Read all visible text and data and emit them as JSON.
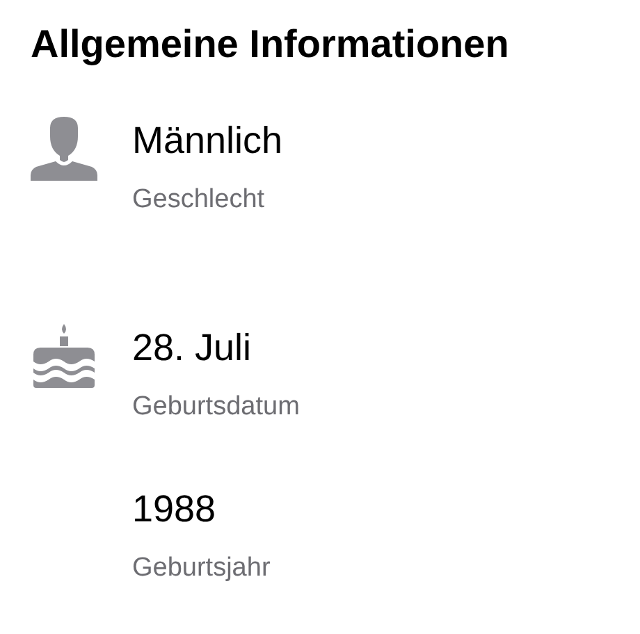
{
  "title": "Allgemeine Informationen",
  "groups": [
    {
      "kind": "person",
      "entries": [
        {
          "value": "Männlich",
          "label": "Geschlecht"
        }
      ]
    },
    {
      "kind": "cake",
      "entries": [
        {
          "value": "28. Juli",
          "label": "Geburtsdatum"
        },
        {
          "value": "1988",
          "label": "Geburtsjahr"
        }
      ]
    }
  ]
}
